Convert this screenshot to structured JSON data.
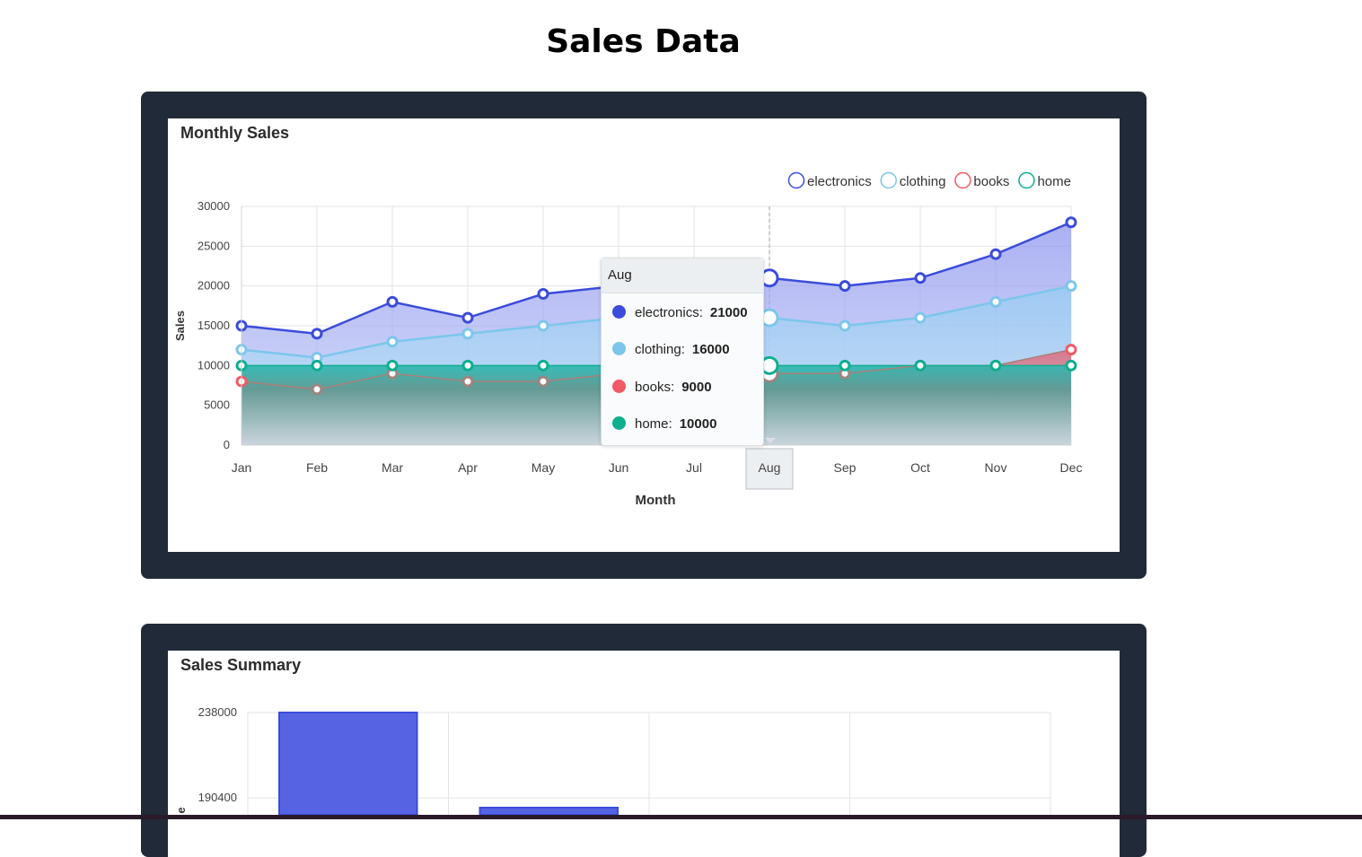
{
  "page": {
    "title": "Sales Data"
  },
  "monthly": {
    "panel_title": "Monthly Sales",
    "tooltip": {
      "header": "Aug",
      "rows": [
        {
          "label": "electronics:",
          "value": "21000",
          "color": "#3b4cdb"
        },
        {
          "label": "clothing:",
          "value": "16000",
          "color": "#7cc6ec"
        },
        {
          "label": "books:",
          "value": "9000",
          "color": "#f15a66"
        },
        {
          "label": "home:",
          "value": "10000",
          "color": "#0fae8f"
        }
      ]
    }
  },
  "summary": {
    "panel_title": "Sales Summary"
  },
  "chart_data": [
    {
      "type": "area",
      "title": "Monthly Sales",
      "xlabel": "Month",
      "ylabel": "Sales",
      "categories": [
        "Jan",
        "Feb",
        "Mar",
        "Apr",
        "May",
        "Jun",
        "Jul",
        "Aug",
        "Sep",
        "Oct",
        "Nov",
        "Dec"
      ],
      "ylim": [
        0,
        30000
      ],
      "yticks": [
        "0",
        "5000",
        "10000",
        "15000",
        "20000",
        "25000",
        "30000"
      ],
      "grid": true,
      "legend_position": "top-right",
      "highlighted_category": "Aug",
      "series": [
        {
          "name": "electronics",
          "color": "#3b4cdb",
          "values": [
            15000,
            14000,
            18000,
            16000,
            19000,
            20000,
            21000,
            21000,
            20000,
            21000,
            24000,
            28000
          ]
        },
        {
          "name": "clothing",
          "color": "#7cc6ec",
          "values": [
            12000,
            11000,
            13000,
            14000,
            15000,
            16000,
            16000,
            16000,
            15000,
            16000,
            18000,
            20000
          ]
        },
        {
          "name": "books",
          "color": "#f15a66",
          "values": [
            8000,
            7000,
            9000,
            8000,
            8000,
            9000,
            9000,
            9000,
            9000,
            10000,
            10000,
            12000
          ]
        },
        {
          "name": "home",
          "color": "#0fae8f",
          "values": [
            10000,
            10000,
            10000,
            10000,
            10000,
            10000,
            10000,
            10000,
            10000,
            10000,
            10000,
            10000
          ]
        }
      ]
    },
    {
      "type": "bar",
      "title": "Sales Summary",
      "ylim": [
        0,
        238000
      ],
      "yticks_visible": [
        "238000",
        "190400"
      ],
      "ylabel_visible_fragment": "e",
      "grid": true,
      "color": "#5664e3",
      "values": [
        238000,
        185000
      ]
    }
  ]
}
